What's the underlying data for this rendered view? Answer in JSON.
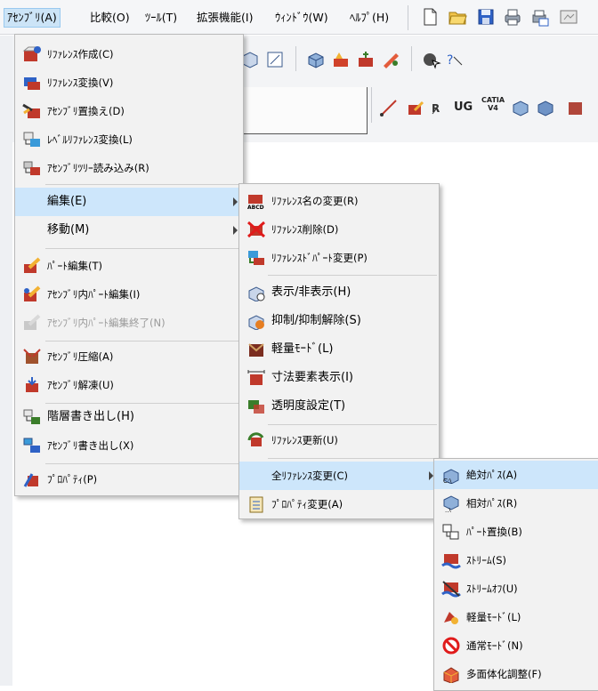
{
  "menubar": {
    "items": [
      {
        "label": "ｱｾﾝﾌﾞﾘ(A)"
      },
      {
        "label": "比較(O)"
      },
      {
        "label": "ﾂｰﾙ(T)"
      },
      {
        "label": "拡張機能(I)"
      },
      {
        "label": "ｳｨﾝﾄﾞｳ(W)"
      },
      {
        "label": "ﾍﾙﾌﾟ(H)"
      }
    ]
  },
  "toolbar": {
    "cad_labels": [
      "UG",
      "CATIA V4"
    ]
  },
  "assembly_menu": {
    "items": [
      {
        "label": "ﾘﾌｧﾚﾝｽ作成(C)",
        "icon": "reference-create-icon"
      },
      {
        "label": "ﾘﾌｧﾚﾝｽ変換(V)",
        "icon": "reference-convert-icon"
      },
      {
        "label": "ｱｾﾝﾌﾞﾘ置換え(D)",
        "icon": "assembly-replace-icon"
      },
      {
        "label": "ﾚﾍﾞﾙﾘﾌｧﾚﾝｽ変換(L)",
        "icon": "level-reference-icon"
      },
      {
        "label": "ｱｾﾝﾌﾞﾘﾂﾘｰ読み込み(R)",
        "icon": "tree-load-icon"
      },
      {
        "label": "編集(E)",
        "icon": ""
      },
      {
        "label": "移動(M)",
        "icon": ""
      },
      {
        "label": "ﾊﾟｰﾄ編集(T)",
        "icon": "part-edit-icon"
      },
      {
        "label": "ｱｾﾝﾌﾞﾘ内ﾊﾟｰﾄ編集(I)",
        "icon": "inner-part-edit-icon"
      },
      {
        "label": "ｱｾﾝﾌﾞﾘ内ﾊﾟｰﾄ編集終了(N)",
        "icon": "inner-part-edit-end-icon"
      },
      {
        "label": "ｱｾﾝﾌﾞﾘ圧縮(A)",
        "icon": "compress-icon"
      },
      {
        "label": "ｱｾﾝﾌﾞﾘ解凍(U)",
        "icon": "decompress-icon"
      },
      {
        "label": "階層書き出し(H)",
        "icon": "hierarchy-export-icon"
      },
      {
        "label": "ｱｾﾝﾌﾞﾘ書き出し(X)",
        "icon": "assembly-export-icon"
      },
      {
        "label": "ﾌﾟﾛﾊﾟﾃｨ(P)",
        "icon": "property-icon"
      }
    ]
  },
  "edit_submenu": {
    "items": [
      {
        "label": "ﾘﾌｧﾚﾝｽ名の変更(R)",
        "icon": "rename-reference-icon"
      },
      {
        "label": "ﾘﾌｧﾚﾝｽ削除(D)",
        "icon": "delete-reference-icon"
      },
      {
        "label": "ﾘﾌｧﾚﾝｽﾄﾞﾊﾟｰﾄ変更(P)",
        "icon": "referenced-part-change-icon"
      },
      {
        "label": "表示/非表示(H)",
        "icon": "show-hide-icon"
      },
      {
        "label": "抑制/抑制解除(S)",
        "icon": "suppress-icon"
      },
      {
        "label": "軽量ﾓｰﾄﾞ(L)",
        "icon": "light-mode-icon"
      },
      {
        "label": "寸法要素表示(I)",
        "icon": "dimension-display-icon"
      },
      {
        "label": "透明度設定(T)",
        "icon": "transparency-icon"
      },
      {
        "label": "ﾘﾌｧﾚﾝｽ更新(U)",
        "icon": "reference-update-icon"
      },
      {
        "label": "全ﾘﾌｧﾚﾝｽ変更(C)",
        "icon": ""
      },
      {
        "label": "ﾌﾟﾛﾊﾟﾃｨ変更(A)",
        "icon": "property-change-icon"
      }
    ]
  },
  "all_reference_submenu": {
    "items": [
      {
        "label": "絶対ﾊﾟｽ(A)",
        "icon": "absolute-path-icon"
      },
      {
        "label": "相対ﾊﾟｽ(R)",
        "icon": "relative-path-icon"
      },
      {
        "label": "ﾊﾟｰﾄ置換(B)",
        "icon": "part-replace-icon"
      },
      {
        "label": "ｽﾄﾘｰﾑ(S)",
        "icon": "stream-icon"
      },
      {
        "label": "ｽﾄﾘｰﾑｵﾌ(U)",
        "icon": "stream-off-icon"
      },
      {
        "label": "軽量ﾓｰﾄﾞ(L)",
        "icon": "light-mode-icon"
      },
      {
        "label": "通常ﾓｰﾄﾞ(N)",
        "icon": "normal-mode-icon"
      },
      {
        "label": "多面体化調整(F)",
        "icon": "polyhedron-adjust-icon"
      }
    ]
  },
  "colors": {
    "highlight": "#cde6fb",
    "menu_bg": "#f2f2f2",
    "menubar_active": "#cce4f7"
  }
}
